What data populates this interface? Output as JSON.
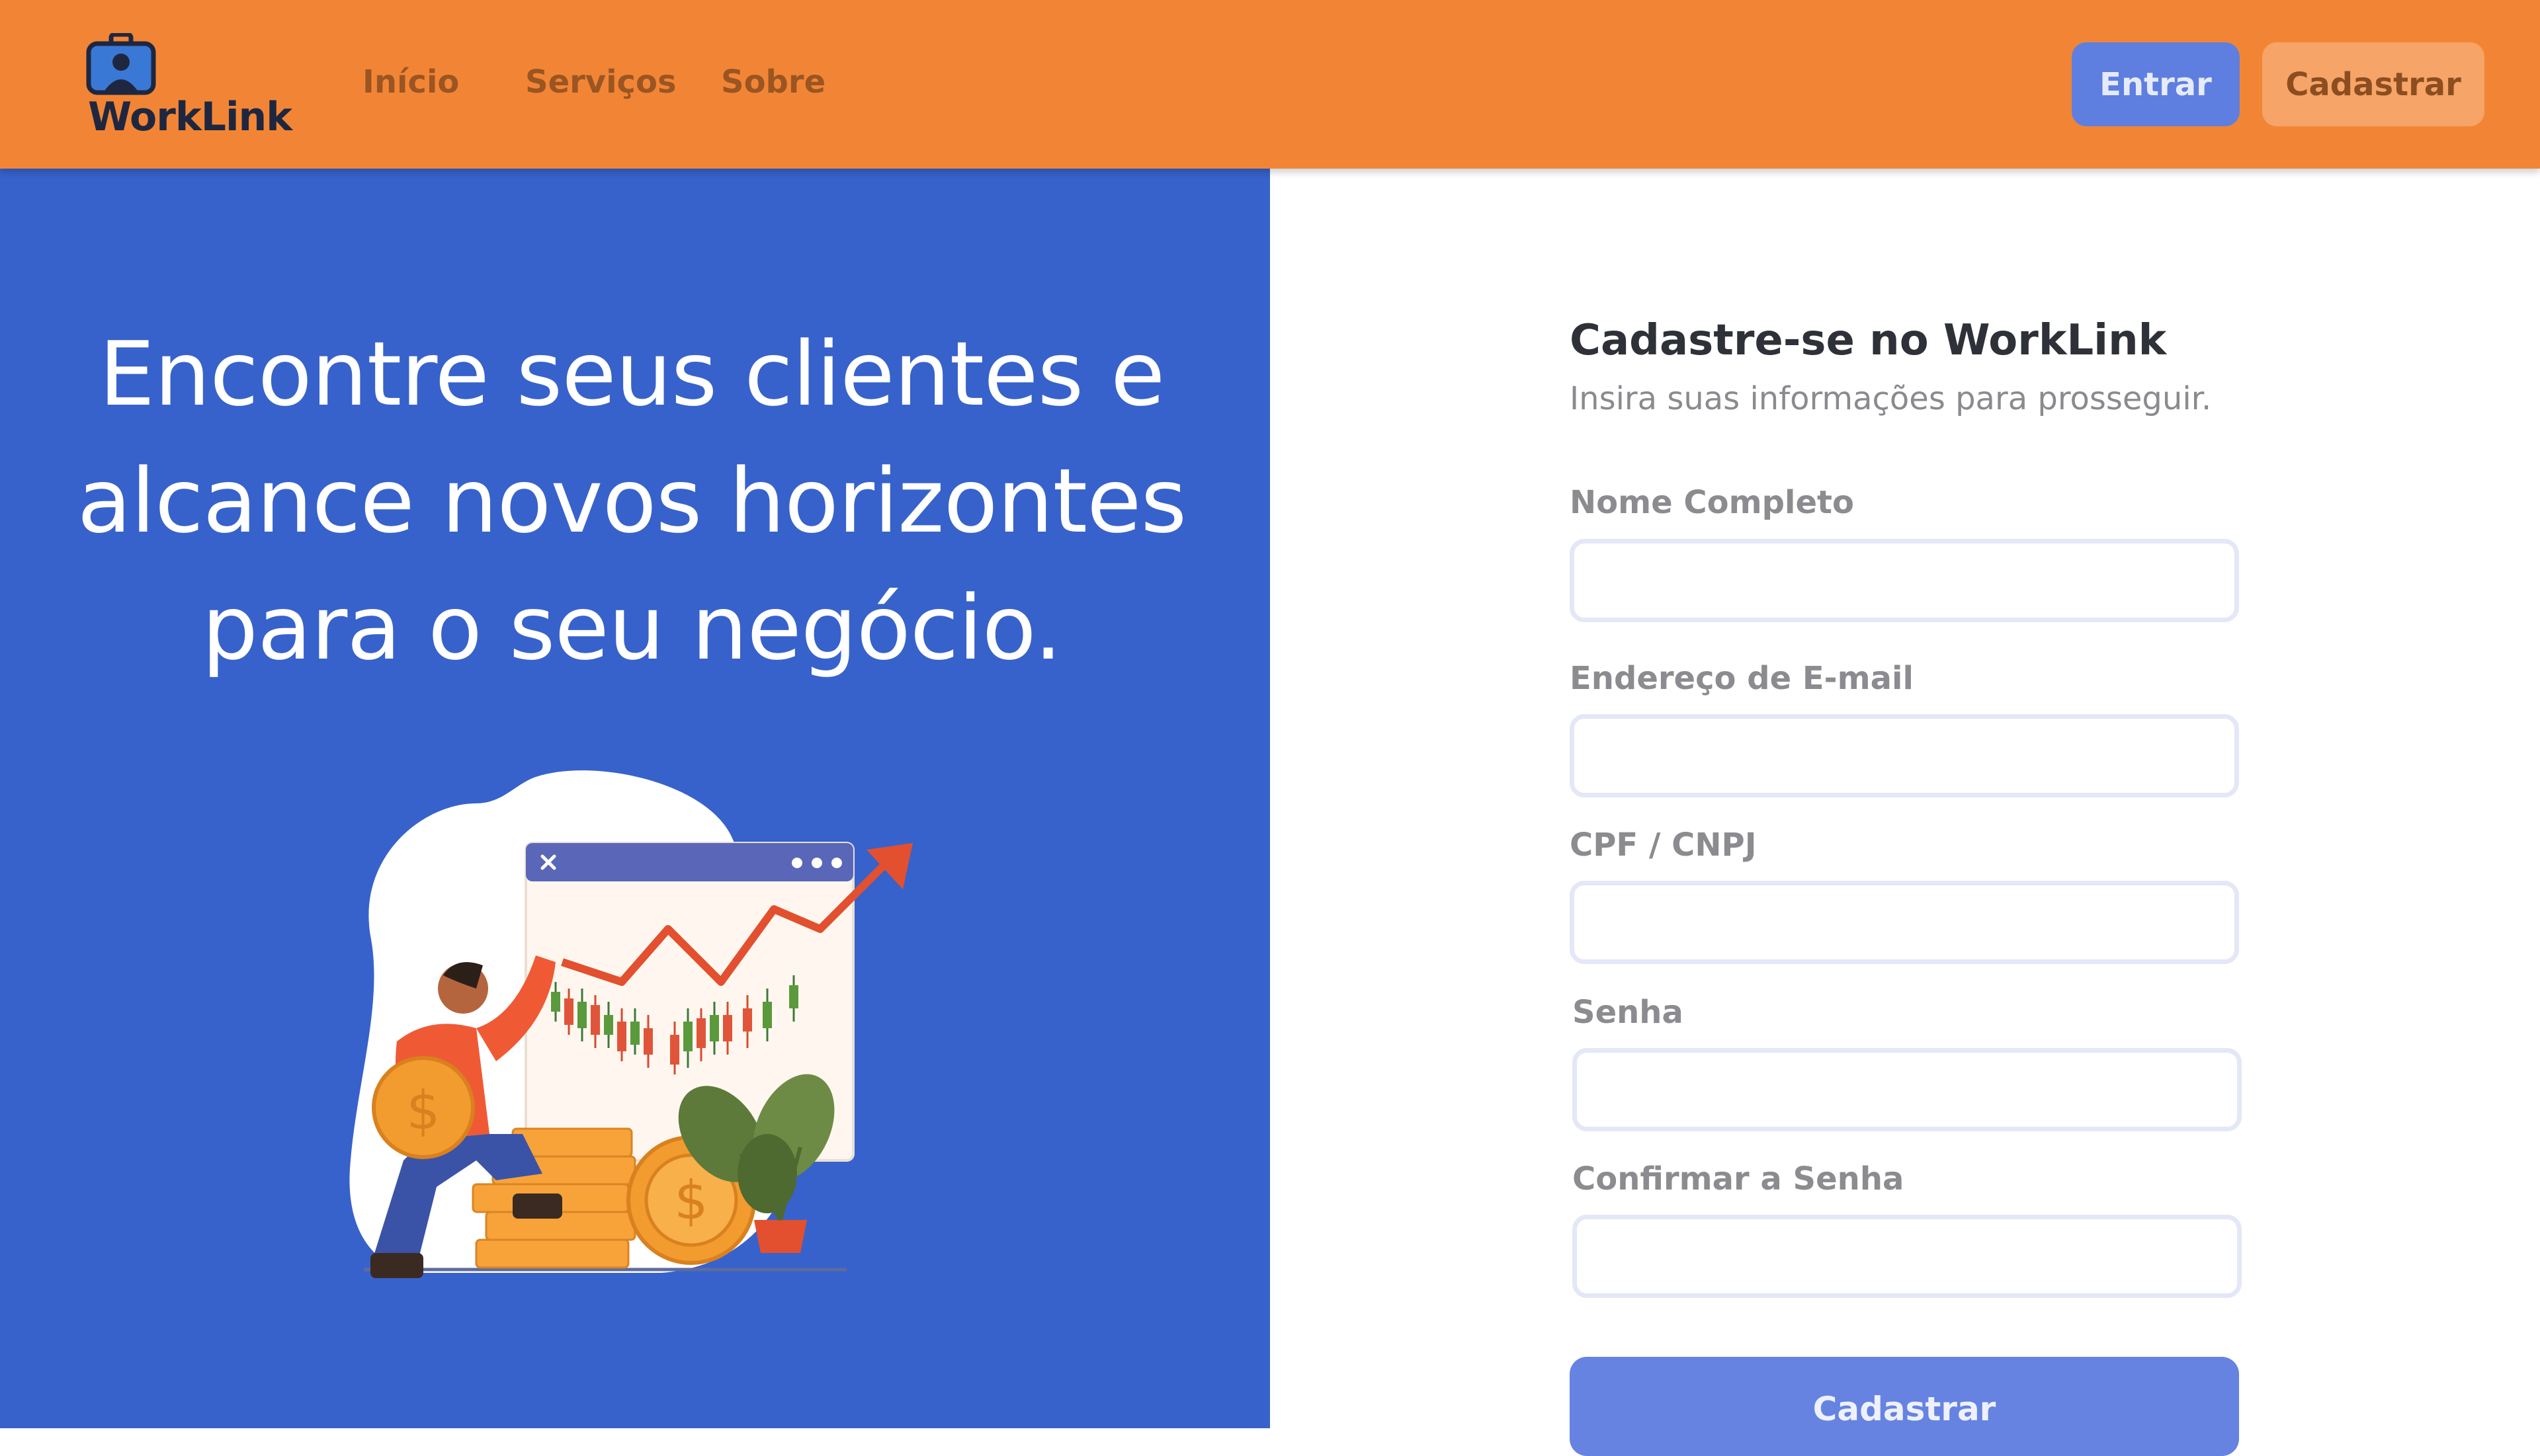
{
  "brand": {
    "name": "WorkLink"
  },
  "nav": {
    "links": [
      {
        "label": "Início"
      },
      {
        "label": "Serviços"
      },
      {
        "label": "Sobre"
      }
    ]
  },
  "auth": {
    "login_label": "Entrar",
    "signup_label": "Cadastrar"
  },
  "hero": {
    "lines": [
      "Encontre seus clientes e",
      "alcance novos horizontes",
      "para o seu negócio."
    ]
  },
  "form": {
    "title": "Cadastre-se no WorkLink",
    "subtitle": "Insira suas informações para prosseguir.",
    "fields": [
      {
        "label": "Nome Completo",
        "value": ""
      },
      {
        "label": "Endereço de E-mail",
        "value": ""
      },
      {
        "label": "CPF / CNPJ",
        "value": ""
      },
      {
        "label": "Senha",
        "value": ""
      },
      {
        "label": "Confirmar a Senha",
        "value": ""
      }
    ],
    "submit_label": "Cadastrar"
  },
  "colors": {
    "header_bg": "#f28535",
    "hero_bg": "#3762cc",
    "primary_button": "#5f7fe0",
    "secondary_button": "#f6a467",
    "submit_button": "#6683e2"
  },
  "icons": {
    "logo": "briefcase-person-icon",
    "chart_close": "close-icon",
    "chart_menu": "more-dots-icon"
  }
}
